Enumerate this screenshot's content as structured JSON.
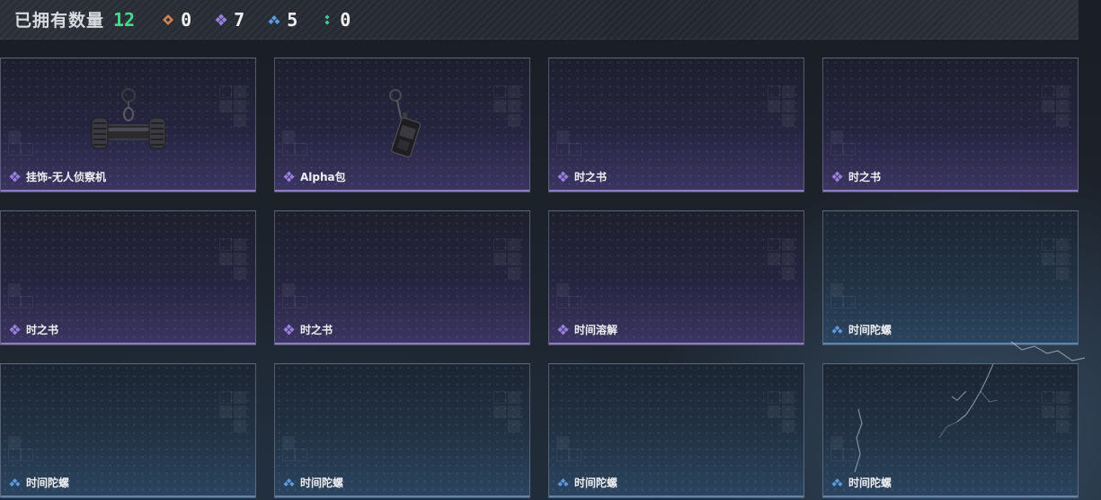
{
  "header": {
    "owned_label": "已拥有数量",
    "owned_count": "12",
    "rarity_counts": [
      {
        "icon": "orange-rarity-icon",
        "color": "#d9834a",
        "value": "0"
      },
      {
        "icon": "purple-rarity-icon",
        "color": "#9b7fe0",
        "value": "7"
      },
      {
        "icon": "blue-rarity-icon",
        "color": "#5b9be0",
        "value": "5"
      },
      {
        "icon": "green-rarity-icon",
        "color": "#3cd29a",
        "value": "0"
      }
    ]
  },
  "colors": {
    "purple": "#9b7fe0",
    "blue": "#5b9be0",
    "green_count": "#3ee08a"
  },
  "items": [
    {
      "name": "挂饰-无人侦察机",
      "rarity": "purple",
      "art": "drone-charm-art"
    },
    {
      "name": "Alpha包",
      "rarity": "purple",
      "art": "alpha-bag-charm-art"
    },
    {
      "name": "时之书",
      "rarity": "purple",
      "art": ""
    },
    {
      "name": "时之书",
      "rarity": "purple",
      "art": ""
    },
    {
      "name": "时之书",
      "rarity": "purple",
      "art": ""
    },
    {
      "name": "时之书",
      "rarity": "purple",
      "art": ""
    },
    {
      "name": "时间溶解",
      "rarity": "purple",
      "art": ""
    },
    {
      "name": "时间陀螺",
      "rarity": "blue",
      "art": ""
    },
    {
      "name": "时间陀螺",
      "rarity": "blue",
      "art": ""
    },
    {
      "name": "时间陀螺",
      "rarity": "blue",
      "art": ""
    },
    {
      "name": "时间陀螺",
      "rarity": "blue",
      "art": ""
    },
    {
      "name": "时间陀螺",
      "rarity": "blue",
      "art": ""
    }
  ]
}
